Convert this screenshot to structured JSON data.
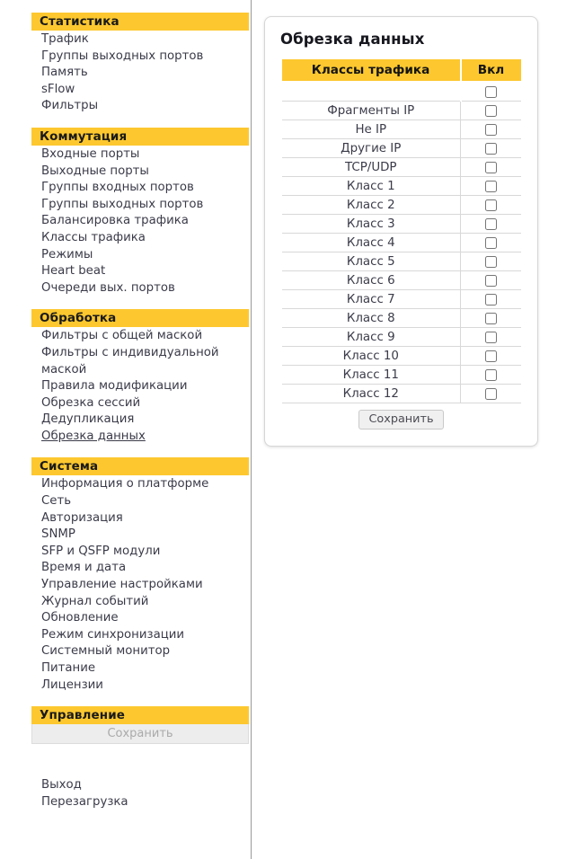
{
  "sidebar": {
    "groups": [
      {
        "header": "Статистика",
        "items": [
          {
            "label": "Трафик",
            "active": false
          },
          {
            "label": "Группы выходных портов",
            "active": false
          },
          {
            "label": "Память",
            "active": false
          },
          {
            "label": "sFlow",
            "active": false
          },
          {
            "label": "Фильтры",
            "active": false
          }
        ]
      },
      {
        "header": "Коммутация",
        "items": [
          {
            "label": "Входные порты",
            "active": false
          },
          {
            "label": "Выходные порты",
            "active": false
          },
          {
            "label": "Группы входных портов",
            "active": false
          },
          {
            "label": "Группы выходных портов",
            "active": false
          },
          {
            "label": "Балансировка трафика",
            "active": false
          },
          {
            "label": "Классы трафика",
            "active": false
          },
          {
            "label": "Режимы",
            "active": false
          },
          {
            "label": "Heart beat",
            "active": false
          },
          {
            "label": "Очереди вых. портов",
            "active": false
          }
        ]
      },
      {
        "header": "Обработка",
        "items": [
          {
            "label": "Фильтры с общей маской",
            "active": false
          },
          {
            "label": "Фильтры с индивидуальной маской",
            "active": false
          },
          {
            "label": "Правила модификации",
            "active": false
          },
          {
            "label": "Обрезка сессий",
            "active": false
          },
          {
            "label": "Дедупликация",
            "active": false
          },
          {
            "label": "Обрезка данных",
            "active": true
          }
        ]
      },
      {
        "header": "Система",
        "items": [
          {
            "label": "Информация о платформе",
            "active": false
          },
          {
            "label": "Сеть",
            "active": false
          },
          {
            "label": "Авторизация",
            "active": false
          },
          {
            "label": "SNMP",
            "active": false
          },
          {
            "label": "SFP и QSFP модули",
            "active": false
          },
          {
            "label": "Время и дата",
            "active": false
          },
          {
            "label": "Управление настройками",
            "active": false
          },
          {
            "label": "Журнал событий",
            "active": false
          },
          {
            "label": "Обновление",
            "active": false
          },
          {
            "label": "Режим синхронизации",
            "active": false
          },
          {
            "label": "Системный монитор",
            "active": false
          },
          {
            "label": "Питание",
            "active": false
          },
          {
            "label": "Лицензии",
            "active": false
          }
        ]
      }
    ],
    "management": {
      "header": "Управление",
      "save_label": "Сохранить",
      "save_disabled": true,
      "links": [
        {
          "label": "Выход"
        },
        {
          "label": "Перезагрузка"
        }
      ]
    }
  },
  "main": {
    "panel_title": "Обрезка данных",
    "table": {
      "columns": [
        "Классы трафика",
        "Вкл"
      ],
      "select_all": {
        "label": "",
        "checked": false
      },
      "rows": [
        {
          "label": "Фрагменты IP",
          "checked": false
        },
        {
          "label": "Не IP",
          "checked": false
        },
        {
          "label": "Другие IP",
          "checked": false
        },
        {
          "label": "TCP/UDP",
          "checked": false
        },
        {
          "label": "Класс 1",
          "checked": false
        },
        {
          "label": "Класс 2",
          "checked": false
        },
        {
          "label": "Класс 3",
          "checked": false
        },
        {
          "label": "Класс 4",
          "checked": false
        },
        {
          "label": "Класс 5",
          "checked": false
        },
        {
          "label": "Класс 6",
          "checked": false
        },
        {
          "label": "Класс 7",
          "checked": false
        },
        {
          "label": "Класс 8",
          "checked": false
        },
        {
          "label": "Класс 9",
          "checked": false
        },
        {
          "label": "Класс 10",
          "checked": false
        },
        {
          "label": "Класс 11",
          "checked": false
        },
        {
          "label": "Класс 12",
          "checked": false
        }
      ]
    },
    "save_label": "Сохранить"
  },
  "colors": {
    "accent_yellow": "#fdc82f",
    "link_text": "#3b3b4a",
    "panel_border": "#d6d6d6",
    "divider": "#999999"
  }
}
